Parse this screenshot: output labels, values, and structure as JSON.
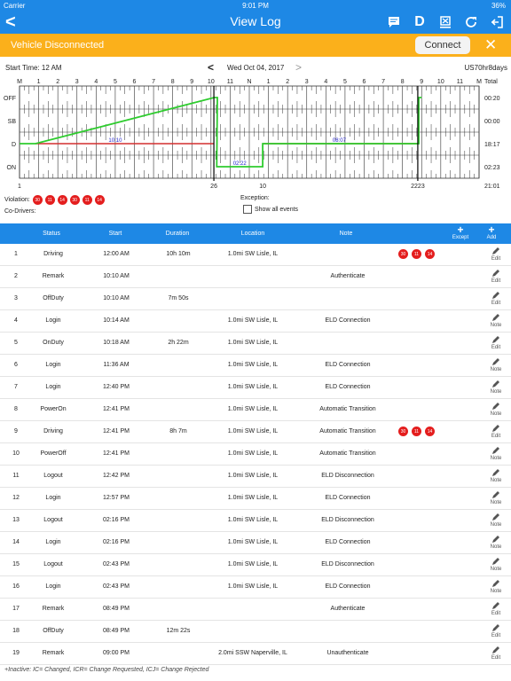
{
  "status_bar": {
    "carrier": "Carrier",
    "time": "9:01 PM",
    "battery": "36%"
  },
  "nav": {
    "back": "<",
    "title": "View Log",
    "icons": [
      "message-icon",
      "d-icon",
      "transfer-icon",
      "refresh-icon",
      "logout-icon"
    ],
    "d_label": "D"
  },
  "banner": {
    "message": "Vehicle Disconnected",
    "connect_label": "Connect",
    "close_label": "✕",
    "color": "#fbb01b"
  },
  "log_header": {
    "start_time": "Start Time: 12 AM",
    "prev": "<",
    "date": "Wed Oct 04, 2017",
    "next": ">",
    "rule": "US70hr8days"
  },
  "chart_data": {
    "type": "line",
    "hour_labels": [
      "M",
      "1",
      "2",
      "3",
      "4",
      "5",
      "6",
      "7",
      "8",
      "9",
      "10",
      "11",
      "N",
      "1",
      "2",
      "3",
      "4",
      "5",
      "6",
      "7",
      "8",
      "9",
      "10",
      "11",
      "M"
    ],
    "total_label": "Total",
    "rows": [
      "OFF",
      "SB",
      "D",
      "ON"
    ],
    "totals": [
      "00:20",
      "00:00",
      "18:17",
      "02:23"
    ],
    "grand_total": "21:01",
    "segments": [
      {
        "status": "D",
        "start": 0,
        "end": 0.833
      },
      {
        "status": "OFF",
        "start": 10.167,
        "end": 10.333
      },
      {
        "status": "ON",
        "start": 10.3,
        "end": 12.7
      },
      {
        "status": "D",
        "start": 12.7,
        "end": 20.85
      },
      {
        "status": "OFF",
        "start": 20.85,
        "end": 21.0
      }
    ],
    "violation_segments": [
      {
        "status": "D",
        "start": 0.833,
        "end": 10.167
      },
      {
        "status": "D",
        "start": 12.7,
        "end": 20.85
      }
    ],
    "segment_labels": [
      {
        "text": "10:10",
        "at": 5.0,
        "status": "D"
      },
      {
        "text": "02:22",
        "at": 11.5,
        "status": "ON"
      },
      {
        "text": "08:07",
        "at": 16.7,
        "status": "D"
      }
    ],
    "markers": [
      {
        "at": 10.15,
        "label": "26"
      },
      {
        "at": 20.8,
        "label": "2223"
      }
    ],
    "bottom_labels": [
      {
        "at": 0,
        "label": "1"
      },
      {
        "at": 12.7,
        "label": "10"
      }
    ],
    "colors": {
      "drive": "#2ecc2e",
      "violation": "#d32f2f",
      "grid": "#333333",
      "label": "#2222cc"
    }
  },
  "violations": {
    "label": "Violation:",
    "codes": [
      "30",
      "11",
      "14",
      "30",
      "11",
      "14"
    ]
  },
  "exception_label": "Exception:",
  "codrivers_label": "Co-Drivers:",
  "show_all_label": "Show all events",
  "table": {
    "headers": {
      "status": "Status",
      "start": "Start",
      "duration": "Duration",
      "location": "Location",
      "remark": "Note",
      "except": "Except",
      "add": "Add",
      "plus": "+"
    },
    "rows": [
      {
        "num": "1",
        "status": "Driving",
        "start": "12:00 AM",
        "duration": "10h 10m",
        "location": "1.0mi SW Lisle, IL",
        "remark": "",
        "violations": [
          "30",
          "11",
          "14"
        ],
        "action": "Edit"
      },
      {
        "num": "2",
        "status": "Remark",
        "start": "10:10 AM",
        "duration": "",
        "location": "",
        "remark": "Authenticate",
        "violations": [],
        "action": "Edit"
      },
      {
        "num": "3",
        "status": "OffDuty",
        "start": "10:10 AM",
        "duration": "7m 50s",
        "location": "",
        "remark": "",
        "violations": [],
        "action": "Edit"
      },
      {
        "num": "4",
        "status": "Login",
        "start": "10:14 AM",
        "duration": "",
        "location": "1.0mi SW Lisle, IL",
        "remark": "ELD Connection",
        "violations": [],
        "action": "Note"
      },
      {
        "num": "5",
        "status": "OnDuty",
        "start": "10:18 AM",
        "duration": "2h 22m",
        "location": "1.0mi SW Lisle, IL",
        "remark": "",
        "violations": [],
        "action": "Edit"
      },
      {
        "num": "6",
        "status": "Login",
        "start": "11:36 AM",
        "duration": "",
        "location": "1.0mi SW Lisle, IL",
        "remark": "ELD Connection",
        "violations": [],
        "action": "Note"
      },
      {
        "num": "7",
        "status": "Login",
        "start": "12:40 PM",
        "duration": "",
        "location": "1.0mi SW Lisle, IL",
        "remark": "ELD Connection",
        "violations": [],
        "action": "Note"
      },
      {
        "num": "8",
        "status": "PowerOn",
        "start": "12:41 PM",
        "duration": "",
        "location": "1.0mi SW Lisle, IL",
        "remark": "Automatic Transition",
        "violations": [],
        "action": "Note"
      },
      {
        "num": "9",
        "status": "Driving",
        "start": "12:41 PM",
        "duration": "8h 7m",
        "location": "1.0mi SW Lisle, IL",
        "remark": "Automatic Transition",
        "violations": [
          "30",
          "11",
          "14"
        ],
        "action": "Edit"
      },
      {
        "num": "10",
        "status": "PowerOff",
        "start": "12:41 PM",
        "duration": "",
        "location": "1.0mi SW Lisle, IL",
        "remark": "Automatic Transition",
        "violations": [],
        "action": "Note"
      },
      {
        "num": "11",
        "status": "Logout",
        "start": "12:42 PM",
        "duration": "",
        "location": "1.0mi SW Lisle, IL",
        "remark": "ELD Disconnection",
        "violations": [],
        "action": "Note"
      },
      {
        "num": "12",
        "status": "Login",
        "start": "12:57 PM",
        "duration": "",
        "location": "1.0mi SW Lisle, IL",
        "remark": "ELD Connection",
        "violations": [],
        "action": "Note"
      },
      {
        "num": "13",
        "status": "Logout",
        "start": "02:16 PM",
        "duration": "",
        "location": "1.0mi SW Lisle, IL",
        "remark": "ELD Disconnection",
        "violations": [],
        "action": "Note"
      },
      {
        "num": "14",
        "status": "Login",
        "start": "02:16 PM",
        "duration": "",
        "location": "1.0mi SW Lisle, IL",
        "remark": "ELD Connection",
        "violations": [],
        "action": "Note"
      },
      {
        "num": "15",
        "status": "Logout",
        "start": "02:43 PM",
        "duration": "",
        "location": "1.0mi SW Lisle, IL",
        "remark": "ELD Disconnection",
        "violations": [],
        "action": "Note"
      },
      {
        "num": "16",
        "status": "Login",
        "start": "02:43 PM",
        "duration": "",
        "location": "1.0mi SW Lisle, IL",
        "remark": "ELD Connection",
        "violations": [],
        "action": "Note"
      },
      {
        "num": "17",
        "status": "Remark",
        "start": "08:49 PM",
        "duration": "",
        "location": "",
        "remark": "Authenticate",
        "violations": [],
        "action": "Edit"
      },
      {
        "num": "18",
        "status": "OffDuty",
        "start": "08:49 PM",
        "duration": "12m 22s",
        "location": "",
        "remark": "",
        "violations": [],
        "action": "Edit"
      },
      {
        "num": "19",
        "status": "Remark",
        "start": "09:00 PM",
        "duration": "",
        "location": "2.0mi SSW Naperville, IL",
        "remark": "Unauthenticate",
        "violations": [],
        "action": "Edit"
      }
    ]
  },
  "footnote": "+Inactive: IC= Changed, ICR= Change Requested, ICJ= Change Rejected"
}
